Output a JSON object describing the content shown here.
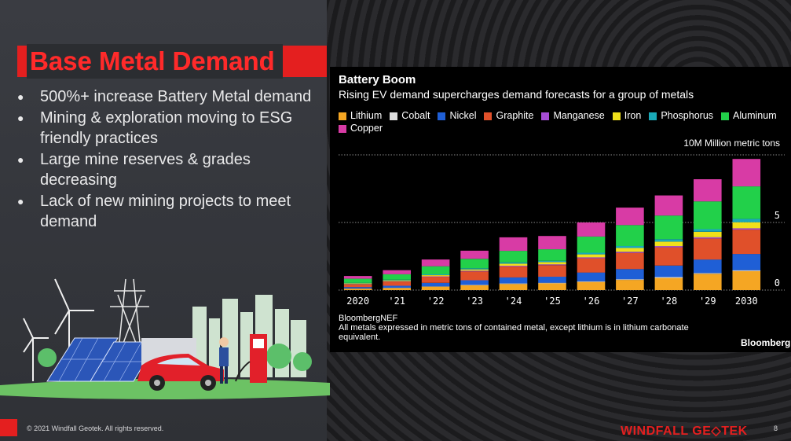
{
  "slide": {
    "title": "Base Metal Demand",
    "bullets": [
      "500%+ increase Battery Metal demand",
      "Mining & exploration moving to ESG friendly practices",
      "Large mine reserves & grades decreasing",
      "Lack of new mining projects to meet demand"
    ],
    "footer": "© 2021 Windfall Geotek. All rights reserved.",
    "brand": "WINDFALL GE◇TEK",
    "page_number": "8"
  },
  "chart_data": {
    "type": "bar",
    "stacked": true,
    "title": "Battery Boom",
    "subtitle": "Rising EV demand supercharges demand forecasts for a group of metals",
    "unit_label": "10M Million metric tons",
    "categories": [
      "2020",
      "'21",
      "'22",
      "'23",
      "'24",
      "'25",
      "'26",
      "'27",
      "'28",
      "'29",
      "2030"
    ],
    "ylim": [
      0,
      10
    ],
    "yticks": [
      {
        "value": 0,
        "label": "0"
      },
      {
        "value": 5,
        "label": "5"
      },
      {
        "value": 10,
        "label": ""
      }
    ],
    "grid": true,
    "legend_position": "top",
    "series": [
      {
        "name": "Lithium",
        "color": "#f5a623",
        "values": [
          0.1,
          0.15,
          0.25,
          0.35,
          0.45,
          0.5,
          0.6,
          0.75,
          0.9,
          1.2,
          1.4
        ]
      },
      {
        "name": "Cobalt",
        "color": "#dddddd",
        "values": [
          0.02,
          0.02,
          0.03,
          0.03,
          0.04,
          0.04,
          0.05,
          0.05,
          0.06,
          0.06,
          0.07
        ]
      },
      {
        "name": "Nickel",
        "color": "#1f5fd6",
        "values": [
          0.1,
          0.15,
          0.25,
          0.35,
          0.45,
          0.45,
          0.65,
          0.75,
          0.85,
          1.0,
          1.2
        ]
      },
      {
        "name": "Graphite",
        "color": "#e0502a",
        "values": [
          0.2,
          0.3,
          0.45,
          0.65,
          0.8,
          0.85,
          1.05,
          1.2,
          1.35,
          1.55,
          1.8
        ]
      },
      {
        "name": "Manganese",
        "color": "#a64dd6",
        "values": [
          0.03,
          0.03,
          0.04,
          0.05,
          0.06,
          0.06,
          0.07,
          0.08,
          0.09,
          0.1,
          0.1
        ]
      },
      {
        "name": "Iron",
        "color": "#f0e01a",
        "values": [
          0.05,
          0.07,
          0.08,
          0.1,
          0.15,
          0.17,
          0.22,
          0.28,
          0.33,
          0.4,
          0.45
        ]
      },
      {
        "name": "Phosphorus",
        "color": "#1aa9b8",
        "values": [
          0.04,
          0.05,
          0.06,
          0.08,
          0.1,
          0.1,
          0.12,
          0.15,
          0.18,
          0.2,
          0.25
        ]
      },
      {
        "name": "Aluminum",
        "color": "#22d04a",
        "values": [
          0.3,
          0.4,
          0.6,
          0.7,
          0.85,
          0.85,
          1.2,
          1.55,
          1.75,
          2.05,
          2.4
        ]
      },
      {
        "name": "Copper",
        "color": "#d83ba5",
        "values": [
          0.2,
          0.3,
          0.5,
          0.6,
          1.0,
          0.98,
          1.04,
          1.29,
          1.49,
          1.64,
          2.03
        ]
      }
    ],
    "source": "BloombergNEF",
    "note": "All metals expressed in metric tons of contained metal, except lithium is in lithium carbonate equivalent.",
    "brand": "Bloomberg"
  }
}
